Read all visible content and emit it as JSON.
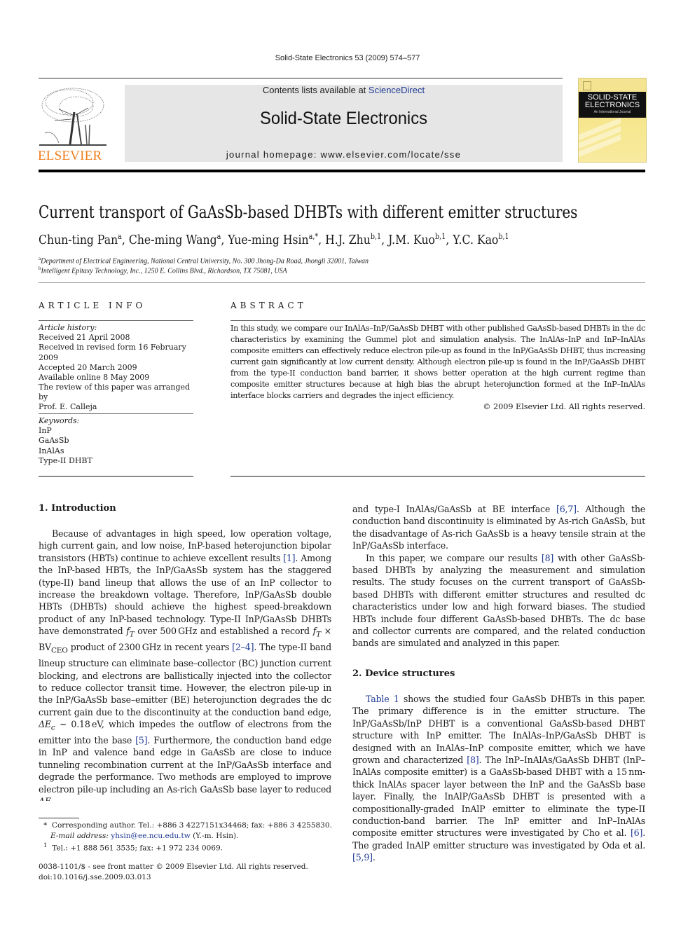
{
  "running_head": "Solid-State Electronics 53 (2009) 574–577",
  "masthead": {
    "contents_prefix": "Contents lists available at ",
    "contents_link": "ScienceDirect",
    "journal_title": "Solid-State Electronics",
    "homepage": "journal homepage: www.elsevier.com/locate/sse",
    "publisher_logo_text": "ELSEVIER",
    "cover_title_line1": "SOLID-STATE",
    "cover_title_line2": "ELECTRONICS",
    "cover_subtitle": "An International Journal",
    "colors": {
      "publisher_orange": "#f07d19",
      "link_blue": "#1f3a93",
      "masthead_bg": "#e6e6e6",
      "cover_yellow": "#f6e68a"
    }
  },
  "article": {
    "title": "Current transport of GaAsSb-based DHBTs with different emitter structures",
    "authors": [
      {
        "name": "Chun-ting Pan",
        "sup": "a"
      },
      {
        "name": "Che-ming Wang",
        "sup": "a"
      },
      {
        "name": "Yue-ming Hsin",
        "sup": "a,*"
      },
      {
        "name": "H.J. Zhu",
        "sup": "b,1"
      },
      {
        "name": "J.M. Kuo",
        "sup": "b,1"
      },
      {
        "name": "Y.C. Kao",
        "sup": "b,1"
      }
    ],
    "affiliations": [
      {
        "mark": "a",
        "text": "Department of Electrical Engineering, National Central University, No. 300 Jhong-Da Road, Jhongli 32001, Taiwan"
      },
      {
        "mark": "b",
        "text": "Intelligent Epitaxy Technology, Inc., 1250 E. Collins Blvd., Richardson, TX 75081, USA"
      }
    ]
  },
  "article_info": {
    "heading": "ARTICLE INFO",
    "history_label": "Article history:",
    "history": [
      "Received 21 April 2008",
      "Received in revised form 16 February 2009",
      "Accepted 20 March 2009",
      "Available online 8 May 2009"
    ],
    "review_note_line1": "The review of this paper was arranged by",
    "review_note_line2": "Prof. E. Calleja",
    "keywords_label": "Keywords:",
    "keywords": [
      "InP",
      "GaAsSb",
      "InAlAs",
      "Type-II DHBT"
    ]
  },
  "abstract": {
    "heading": "ABSTRACT",
    "text": "In this study, we compare our InAlAs–InP/GaAsSb DHBT with other published GaAsSb-based DHBTs in the dc characteristics by examining the Gummel plot and simulation analysis. The InAlAs–InP and InP–InAlAs composite emitters can effectively reduce electron pile-up as found in the InP/GaAsSb DHBT, thus increasing current gain significantly at low current density. Although electron pile-up is found in the InP/GaAsSb DHBT from the type-II conduction band barrier, it shows better operation at the high current regime than composite emitter structures because at high bias the abrupt heterojunction formed at the InP–InAlAs interface blocks carriers and degrades the inject efficiency.",
    "copyright": "© 2009 Elsevier Ltd. All rights reserved."
  },
  "body": {
    "intro_heading": "1. Introduction",
    "intro_p1_a": "Because of advantages in high speed, low operation voltage, high current gain, and low noise, InP-based heterojunction bipolar transistors (HBTs) continue to achieve excellent results ",
    "ref_1": "[1]",
    "intro_p1_b": ". Among the InP-based HBTs, the InP/GaAsSb system has the staggered (type-II) band lineup that allows the use of an InP collector to increase the breakdown voltage. Therefore, InP/GaAsSb double HBTs (DHBTs) should achieve the highest speed-breakdown product of any InP-based technology. Type-II InP/GaAsSb DHBTs have demonstrated ",
    "ft": "f",
    "ft_sub": "T",
    "intro_p1_c": " over 500 GHz and established a record ",
    "intro_p1_d": " × BV",
    "bvceo_sub": "CEO",
    "intro_p1_e": " product of 2300 GHz in recent years ",
    "ref_2_4": "[2–4]",
    "intro_p1_f": ". The type-II band lineup structure can eliminate base–collector (BC) junction current blocking, and electrons are ballistically injected into the collector to reduce collector transit time. However, the electron pile-up in the InP/GaAsSb base–emitter (BE) heterojunction degrades the dc current gain due to the discontinuity at the conduction band edge, ",
    "delta_ec": "ΔE",
    "ec_sub": "c",
    "intro_p1_g": " ~ 0.18 eV, which impedes the outflow of electrons from the emitter into the base ",
    "ref_5": "[5]",
    "intro_p1_h": ". Furthermore, the conduction band edge in InP and valence band edge in GaAsSb are close to induce tunneling recombination current at the InP/GaAsSb interface and degrade the performance. Two methods are employed to improve electron pile-up including an As-rich GaAsSb base layer to reduced ",
    "intro_p1_i": " and type-I InAlAs/GaAsSb at BE interface ",
    "ref_6_7": "[6,7]",
    "intro_p1_j": ". Although the conduction band discontinuity is eliminated by As-rich GaAsSb, but the disadvantage of As-rich GaAsSb is a heavy tensile strain at the InP/GaAsSb interface.",
    "intro_p2_a": "In this paper, we compare our results ",
    "ref_8": "[8]",
    "intro_p2_b": " with other GaAsSb-based DHBTs by analyzing the measurement and simulation results. The study focuses on the current transport of GaAsSb-based DHBTs with different emitter structures and resulted dc characteristics under low and high forward biases. The studied HBTs include four different GaAsSb-based DHBTs. The dc base and collector currents are compared, and the related conduction bands are simulated and analyzed in this paper.",
    "device_heading": "2. Device structures",
    "table_ref": "Table 1",
    "dev_p1_a": " shows the studied four GaAsSb DHBTs in this paper. The primary difference is in the emitter structure. The InP/GaAsSb/InP DHBT is a conventional GaAsSb-based DHBT structure with InP emitter. The InAlAs–InP/GaAsSb DHBT is designed with an InAlAs–InP composite emitter, which we have grown and characterized ",
    "dev_ref_8": "[8]",
    "dev_p1_b": ". The InP–InAlAs/GaAsSb DHBT (InP–InAlAs composite emitter) is a GaAsSb-based DHBT with a 15 nm-thick InAlAs spacer layer between the InP and the GaAsSb base layer. Finally, the InAlP/GaAsSb DHBT is presented with a compositionally-graded InAlP emitter to eliminate the type-II conduction-band barrier. The InP emitter and InP–InAlAs composite emitter structures were investigated by Cho et al. ",
    "ref_6": "[6]",
    "dev_p1_c": ". The graded InAlP emitter structure was investigated by Oda et al. ",
    "ref_5_9": "[5,9]",
    "dev_p1_d": "."
  },
  "footnotes": {
    "corr_mark": "*",
    "corr_text": "Corresponding author. Tel.: +886 3 4227151x34468; fax: +886 3 4255830.",
    "email_label": "E-mail address: ",
    "email": "yhsin@ee.ncu.edu.tw",
    "email_suffix": " (Y.-m. Hsin).",
    "note1_mark": "1",
    "note1_text": "Tel.: +1 888 561 3535; fax: +1 972 234 0069.",
    "front_matter": "0038-1101/$ - see front matter © 2009 Elsevier Ltd. All rights reserved.",
    "doi": "doi:10.1016/j.sse.2009.03.013"
  }
}
